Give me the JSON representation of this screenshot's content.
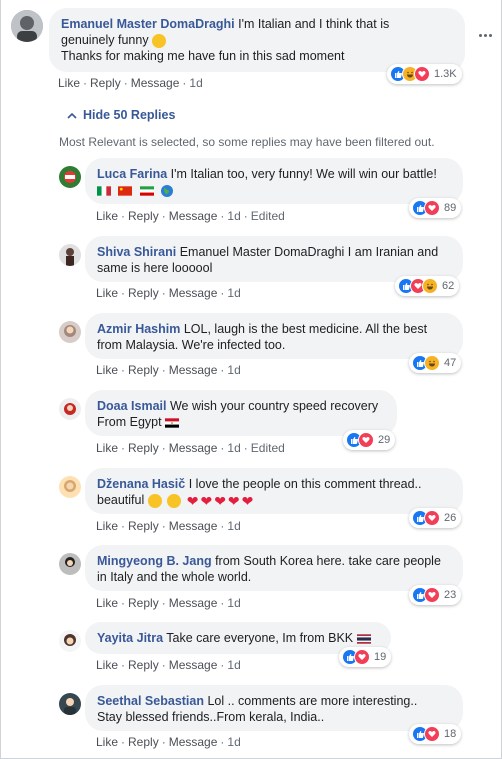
{
  "main_comment": {
    "author": "Emanuel Master DomaDraghi",
    "text_line1": "I'm Italian and I think that is",
    "text_line2": "genuinely funny",
    "text_line3": "Thanks for making me have fun in this sad moment",
    "actions": {
      "like": "Like",
      "reply": "Reply",
      "message": "Message",
      "time": "1d"
    },
    "reaction_count": "1.3K"
  },
  "replies_toggle": {
    "label": "Hide 50 Replies"
  },
  "filter_note": "Most Relevant is selected, so some replies may have been filtered out.",
  "replies": [
    {
      "author": "Luca Farina",
      "line1": "I'm Italian too, very funny! We will win our battle!",
      "line2": "",
      "time": "1d",
      "edited": "Edited",
      "count": "89"
    },
    {
      "author": "Shiva Shirani",
      "line1": "Emanuel Master DomaDraghi I am Iranian and",
      "line2": "same is here loooool",
      "time": "1d",
      "edited": "",
      "count": "62"
    },
    {
      "author": "Azmir Hashim",
      "line1": "LOL, laugh is the best medicine. All the best",
      "line2": "from Malaysia. We're infected too.",
      "time": "1d",
      "edited": "",
      "count": "47"
    },
    {
      "author": "Doaa Ismail",
      "line1": "We wish your country speed recovery",
      "line2": "From Egypt",
      "time": "1d",
      "edited": "Edited",
      "count": "29"
    },
    {
      "author": "Dženana Hasič",
      "line1": "I love the people on this comment thread..",
      "line2": "beautiful",
      "time": "1d",
      "edited": "",
      "count": "26"
    },
    {
      "author": "Mingyeong B. Jang",
      "line1": "from South Korea here. take care people",
      "line2": "in Italy and the whole world.",
      "time": "1d",
      "edited": "",
      "count": "23"
    },
    {
      "author": "Yayita Jitra",
      "line1": "Take care everyone, Im from BKK",
      "line2": "",
      "time": "1d",
      "edited": "",
      "count": "19"
    },
    {
      "author": "Seethal Sebastian",
      "line1": "Lol .. comments are more interesting..",
      "line2": "Stay blessed friends..From kerala, India..",
      "time": "1d",
      "edited": "",
      "count": "18"
    }
  ],
  "action_labels": {
    "like": "Like",
    "reply": "Reply",
    "message": "Message"
  },
  "colors": {
    "link": "#385898",
    "bubble": "#f2f3f5",
    "like": "#1877f2",
    "love": "#f33e58",
    "haha": "#f7b125"
  }
}
